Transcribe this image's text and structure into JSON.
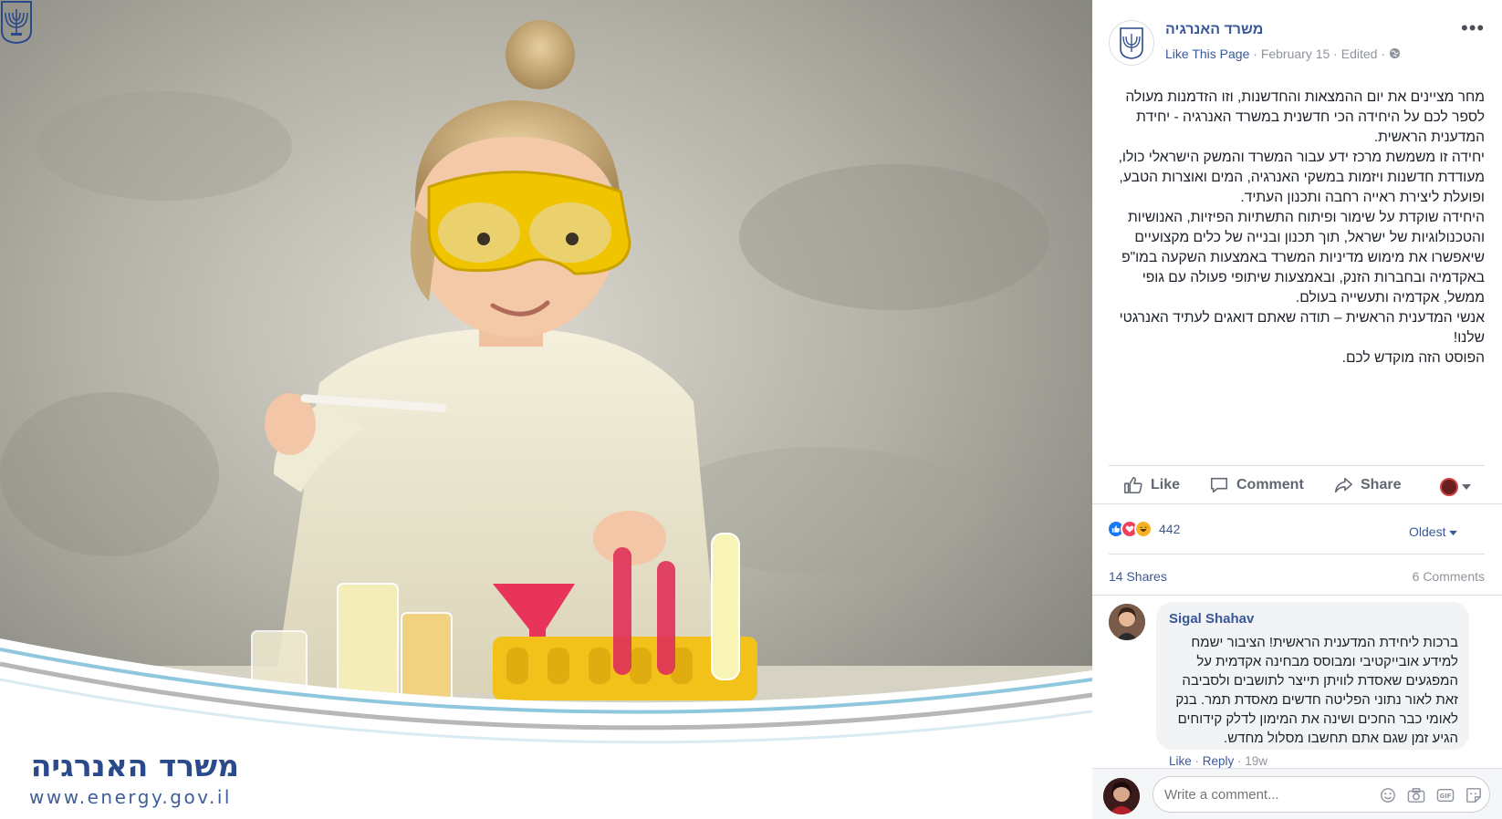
{
  "photo": {
    "brand_name": "משרד האנרגיה",
    "brand_url": "www.energy.gov.il"
  },
  "post": {
    "page_name": "משרד האנרגיה",
    "like_page": "Like This Page",
    "dot1": " · ",
    "date": "February 15",
    "dot2": " · ",
    "edited": "Edited",
    "dot3": " · ",
    "more": "•••",
    "text_lines": [
      "מחר מציינים את יום ההמצאות והחדשנות, וזו הזדמנות מעולה לספר לכם על היחידה הכי חדשנית במשרד האנרגיה - יחידת המדענית הראשית.",
      "יחידה זו משמשת מרכז ידע עבור המשרד והמשק הישראלי כולו, מעודדת חדשנות ויזמות במשקי האנרגיה, המים ואוצרות הטבע, ופועלת ליצירת ראייה רחבה ותכנון העתיד.",
      "היחידה שוקדת על שימור ופיתוח התשתיות הפיזיות, האנושיות והטכנולוגיות של ישראל, תוך תכנון ובנייה של כלים מקצועיים שיאפשרו את מימוש מדיניות המשרד באמצעות השקעה במו\"פ באקדמיה ובחברות הזנק, ובאמצעות שיתופי פעולה עם גופי ממשל, אקדמיה ותעשייה בעולם.",
      "אנשי המדענית הראשית – תודה שאתם דואגים לעתיד האנרגטי שלנו!",
      "הפוסט הזה מוקדש לכם."
    ]
  },
  "actions": {
    "like": "Like",
    "comment": "Comment",
    "share": "Share"
  },
  "stats": {
    "reactions_count": "442",
    "sort": "Oldest",
    "shares": "14 Shares",
    "comments": "6 Comments"
  },
  "comment": {
    "author": "Sigal Shahav",
    "text": "ברכות ליחידת המדענית הראשית! הציבור ישמח למידע אובייקטיבי ומבוסס מבחינה אקדמית על המפגעים שאסדת לוויתן תייצר לתושבים ולסביבה זאת לאור נתוני הפליטה חדשים מאסדת תמר. בנק לאומי כבר החכים ושינה את המימון לדלק קידוחים הגיע זמן שגם אתם תחשבו מסלול מחדש.",
    "like": "Like",
    "reply": "Reply",
    "sep1": " · ",
    "sep2": " · ",
    "time": "19w"
  },
  "composer": {
    "placeholder": "Write a comment..."
  },
  "colors": {
    "link": "#385898",
    "muted": "#90949c",
    "text": "#1d2129",
    "like_blue": "#1877f2",
    "love_red": "#f33e58",
    "haha_yellow": "#f7b125"
  },
  "icons": [
    "thumbs-up-icon",
    "comment-icon",
    "share-icon",
    "chevron-down-icon",
    "emoji-icon",
    "camera-icon",
    "gif-icon",
    "sticker-icon",
    "globe-icon",
    "menorah-emblem-icon"
  ]
}
